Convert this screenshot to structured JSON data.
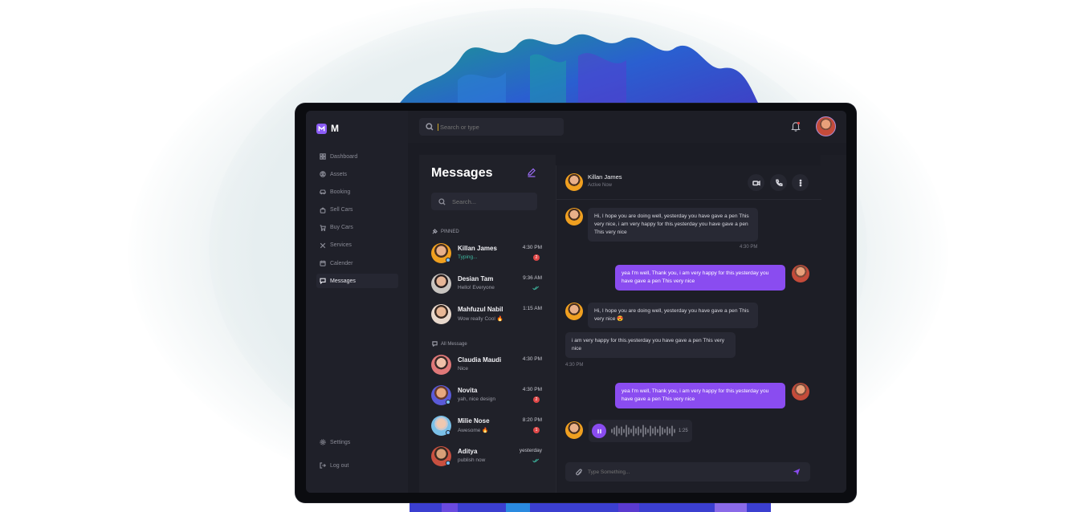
{
  "app": {
    "logo_text": "M"
  },
  "topbar": {
    "search_placeholder": "Search or type"
  },
  "sidebar": {
    "items": [
      {
        "label": "Dashboard",
        "icon": "grid-icon",
        "active": false
      },
      {
        "label": "Assets",
        "icon": "user-circle-icon",
        "active": false
      },
      {
        "label": "Booking",
        "icon": "car-icon",
        "active": false
      },
      {
        "label": "Sell Cars",
        "icon": "bag-icon",
        "active": false
      },
      {
        "label": "Buy Cars",
        "icon": "cart-icon",
        "active": false
      },
      {
        "label": "Services",
        "icon": "tools-icon",
        "active": false
      },
      {
        "label": "Calender",
        "icon": "calendar-icon",
        "active": false
      },
      {
        "label": "Messages",
        "icon": "chat-icon",
        "active": true
      }
    ],
    "bottom": [
      {
        "label": "Settings",
        "icon": "gear-icon"
      },
      {
        "label": "Log out",
        "icon": "logout-icon"
      }
    ]
  },
  "messages_panel": {
    "title": "Messages",
    "search_placeholder": "Search...",
    "pinned_label": "PINNED",
    "all_label": "All Message",
    "pinned": [
      {
        "name": "Killan James",
        "preview": "Typing...",
        "time": "4:30 PM",
        "badge": "2",
        "typing": true
      },
      {
        "name": "Desian Tam",
        "preview": "Hello! Everyone",
        "time": "9:36 AM",
        "read": true
      },
      {
        "name": "Mahfuzul Nabil",
        "preview": "Wow really Cool 🔥",
        "time": "1:15 AM"
      }
    ],
    "all": [
      {
        "name": "Claudia Maudi",
        "preview": "Nice",
        "time": "4:30 PM"
      },
      {
        "name": "Novita",
        "preview": "yah, nice design",
        "time": "4:30 PM",
        "badge": "2"
      },
      {
        "name": "Milie Nose",
        "preview": "Awesome 🔥",
        "time": "8:20 PM",
        "badge": "1"
      },
      {
        "name": "Aditya",
        "preview": "publish now",
        "time": "yesterday",
        "read": true
      }
    ]
  },
  "chat": {
    "contact_name": "Killan James",
    "contact_status": "Active Now",
    "messages": [
      {
        "text": "Hi, I hope you are doing well, yesterday you have gave a pen This very nice, i am very happy for this.yesterday you have gave a pen This very nice",
        "time": "4:30 PM"
      },
      {
        "text": "yea I'm well, Thank you, i am very happy for this.yesterday you have gave a pen This very nice"
      },
      {
        "text": "Hi, I hope you are doing well, yesterday you have gave a pen This very nice 😍"
      },
      {
        "text": "i am very happy for this.yesterday you have gave a pen This very nice",
        "time": "4:30 PM"
      },
      {
        "text": "yea I'm well, Thank you, i am very happy for this.yesterday you have gave a pen This very nice"
      }
    ],
    "voice_duration": "1:25",
    "composer_placeholder": "Type Something..."
  },
  "colors": {
    "accent": "#8a4cf0",
    "background": "#1b1c24",
    "badge": "#e04848",
    "typing": "#3fb8a0"
  }
}
